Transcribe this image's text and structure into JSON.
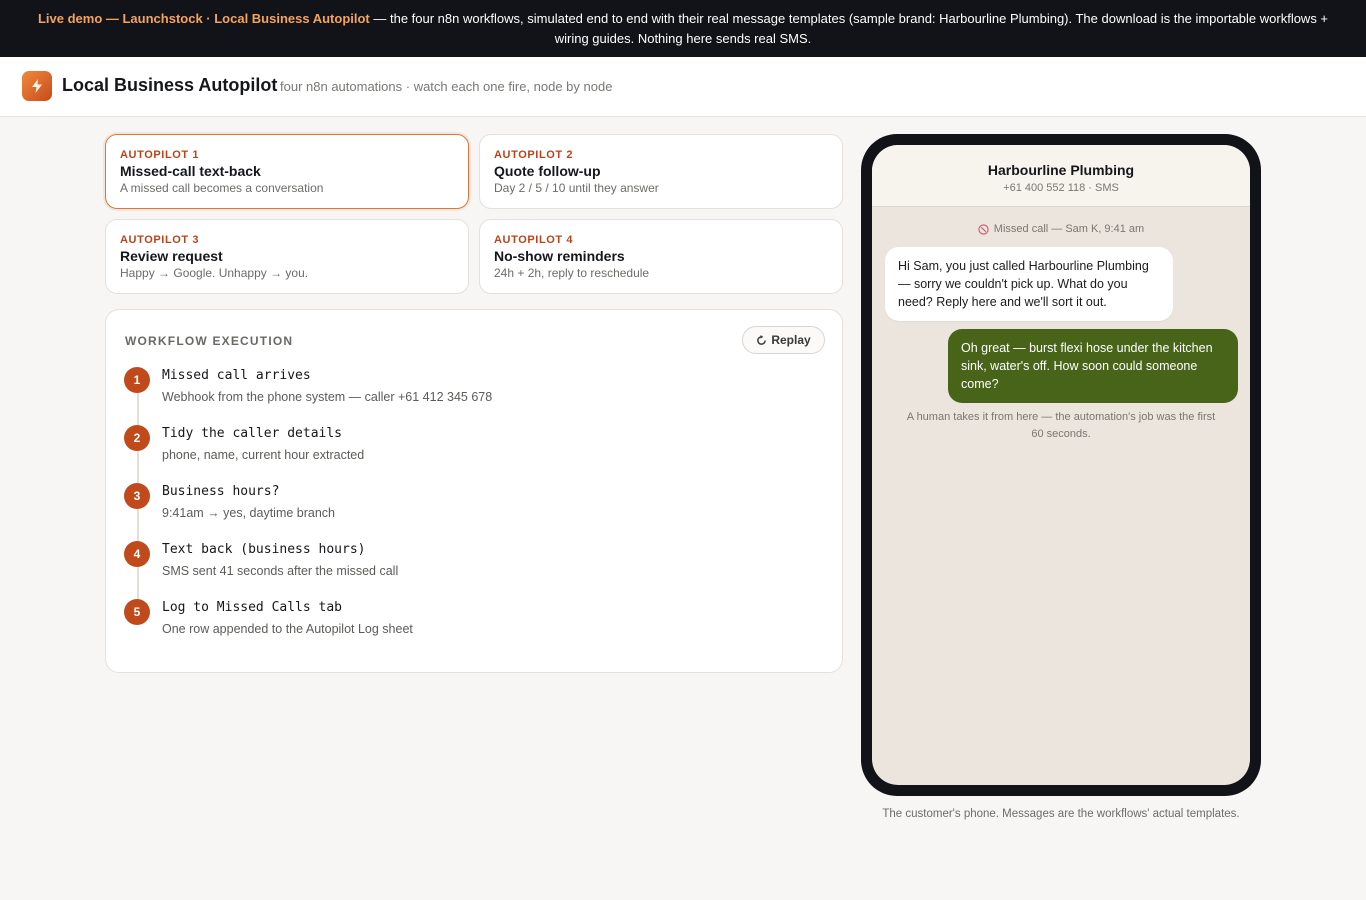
{
  "banner": {
    "highlight_1": "Live demo — Launchstock · Local Business Autopilot",
    "text": " — the four n8n workflows, simulated end to end with their real message templates (sample brand: Harbourline Plumbing). The download is the importable workflows + wiring guides. Nothing here sends real SMS."
  },
  "header": {
    "logo_icon": "lightning-bolt-icon",
    "title": "Local Business Autopilot",
    "subtitle": "four n8n automations · watch each one fire, node by node"
  },
  "autopilots": [
    {
      "kicker": "AUTOPILOT 1",
      "title": "Missed-call text-back",
      "subtitle": "A missed call becomes a conversation",
      "active": true
    },
    {
      "kicker": "AUTOPILOT 2",
      "title": "Quote follow-up",
      "subtitle": "Day 2 / 5 / 10 until they answer",
      "active": false
    },
    {
      "kicker": "AUTOPILOT 3",
      "title": "Review request",
      "subtitle": "Happy → Google. Unhappy → you.",
      "active": false
    },
    {
      "kicker": "AUTOPILOT 4",
      "title": "No-show reminders",
      "subtitle": "24h + 2h, reply to reschedule",
      "active": false
    }
  ],
  "workflow": {
    "label": "WORKFLOW EXECUTION",
    "replay_label": "Replay",
    "replay_icon": "replay-arrow-icon",
    "steps": [
      {
        "num": "1",
        "title": "Missed call arrives",
        "desc": "Webhook from the phone system — caller +61 412 345 678"
      },
      {
        "num": "2",
        "title": "Tidy the caller details",
        "desc": "phone, name, current hour extracted"
      },
      {
        "num": "3",
        "title": "Business hours?",
        "desc": "9:41am → yes, daytime branch"
      },
      {
        "num": "4",
        "title": "Text back (business hours)",
        "desc": "SMS sent 41 seconds after the missed call"
      },
      {
        "num": "5",
        "title": "Log to Missed Calls tab",
        "desc": "One row appended to the Autopilot Log sheet"
      }
    ]
  },
  "phone": {
    "contact": "Harbourline Plumbing",
    "contact_sub": "+61 400 552 118 · SMS",
    "system_icon": "missed-call-icon",
    "system_msg": "Missed call — Sam K, 9:41 am",
    "incoming": "Hi Sam, you just called Harbourline Plumbing — sorry we couldn't pick up. What do you need? Reply here and we'll sort it out.",
    "outgoing": "Oh great — burst flexi hose under the kitchen sink, water's off. How soon could someone come?",
    "footnote": "A human takes it from here — the automation's job was the first 60 seconds."
  },
  "caption": "The customer's phone. Messages are the workflows' actual templates.",
  "colors": {
    "accent": "#c04a1c",
    "banner_bg": "#111318",
    "outgoing_bubble": "#476419"
  }
}
